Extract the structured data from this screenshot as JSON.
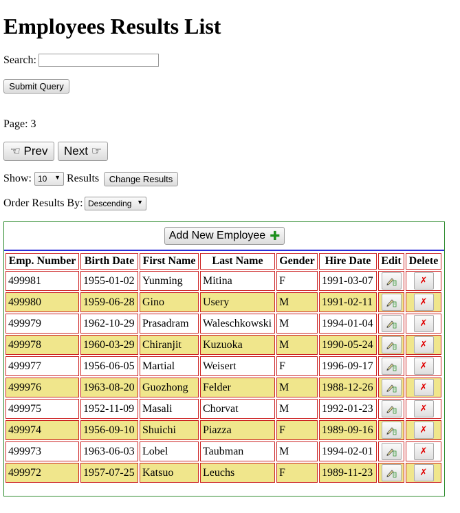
{
  "title": "Employees Results List",
  "search": {
    "label": "Search:",
    "value": "",
    "submit_label": "Submit Query"
  },
  "page": {
    "label": "Page: 3"
  },
  "nav": {
    "prev_label": "☜ Prev",
    "next_label": "Next ☞"
  },
  "show": {
    "label": "Show:",
    "value": "10",
    "suffix": "Results",
    "button_label": "Change Results"
  },
  "order": {
    "label": "Order Results By:",
    "value": "Descending"
  },
  "add_button": {
    "label": "Add New Employee",
    "icon": "plus-icon",
    "icon_color": "#1a8f1a"
  },
  "table": {
    "headers": [
      "Emp. Number",
      "Birth Date",
      "First Name",
      "Last Name",
      "Gender",
      "Hire Date",
      "Edit",
      "Delete"
    ],
    "rows": [
      [
        "499981",
        "1955-01-02",
        "Yunming",
        "Mitina",
        "F",
        "1991-03-07"
      ],
      [
        "499980",
        "1959-06-28",
        "Gino",
        "Usery",
        "M",
        "1991-02-11"
      ],
      [
        "499979",
        "1962-10-29",
        "Prasadram",
        "Waleschkowski",
        "M",
        "1994-01-04"
      ],
      [
        "499978",
        "1960-03-29",
        "Chiranjit",
        "Kuzuoka",
        "M",
        "1990-05-24"
      ],
      [
        "499977",
        "1956-06-05",
        "Martial",
        "Weisert",
        "F",
        "1996-09-17"
      ],
      [
        "499976",
        "1963-08-20",
        "Guozhong",
        "Felder",
        "M",
        "1988-12-26"
      ],
      [
        "499975",
        "1952-11-09",
        "Masali",
        "Chorvat",
        "M",
        "1992-01-23"
      ],
      [
        "499974",
        "1956-09-10",
        "Shuichi",
        "Piazza",
        "F",
        "1989-09-16"
      ],
      [
        "499973",
        "1963-06-03",
        "Lobel",
        "Taubman",
        "M",
        "1994-02-01"
      ],
      [
        "499972",
        "1957-07-25",
        "Katsuo",
        "Leuchs",
        "F",
        "1989-11-23"
      ]
    ],
    "edit_icon": "edit-icon",
    "delete_icon": "delete-x-icon",
    "delete_color": "#e00000",
    "alt_row_color": "#f0e68c",
    "border_color": "#cc2222"
  }
}
